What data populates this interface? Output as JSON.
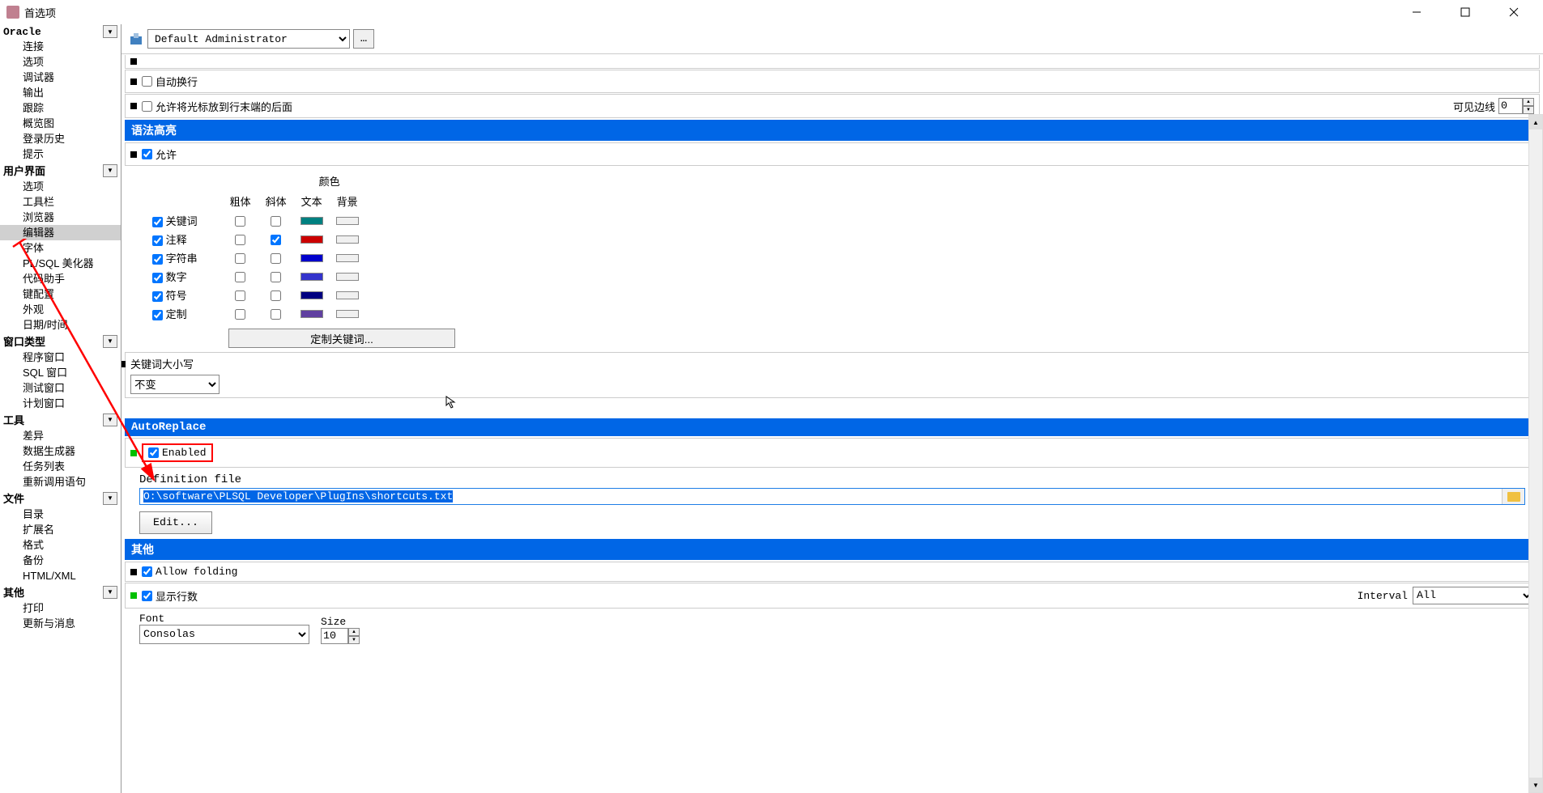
{
  "window": {
    "title": "首选项"
  },
  "sidebar": {
    "categories": [
      {
        "name": "Oracle",
        "items": [
          "连接",
          "选项",
          "调试器",
          "输出",
          "跟踪",
          "概览图",
          "登录历史",
          "提示"
        ]
      },
      {
        "name": "用户界面",
        "items": [
          "选项",
          "工具栏",
          "浏览器",
          "编辑器",
          "字体",
          "PL/SQL 美化器",
          "代码助手",
          "键配置",
          "外观",
          "日期/时间"
        ],
        "selected": "编辑器"
      },
      {
        "name": "窗口类型",
        "items": [
          "程序窗口",
          "SQL 窗口",
          "测试窗口",
          "计划窗口"
        ]
      },
      {
        "name": "工具",
        "items": [
          "差异",
          "数据生成器",
          "任务列表",
          "重新调用语句"
        ]
      },
      {
        "name": "文件",
        "items": [
          "目录",
          "扩展名",
          "格式",
          "备份",
          "HTML/XML"
        ]
      },
      {
        "name": "其他",
        "items": [
          "打印",
          "更新与消息"
        ]
      }
    ]
  },
  "toolbar": {
    "admin_label": "Default Administrator",
    "more": "..."
  },
  "auto_wrap": {
    "label": "自动换行"
  },
  "cursor_allow": {
    "label": "允许将光标放到行末端的后面",
    "visible_border": "可见边线",
    "value": "0"
  },
  "syntax": {
    "header": "语法高亮",
    "allow": "允许",
    "color_title": "颜色",
    "cols": {
      "bold": "粗体",
      "italic": "斜体",
      "text": "文本",
      "bg": "背景"
    },
    "rows": [
      {
        "name": "关键词",
        "checked": true,
        "bold": false,
        "italic": false,
        "text_color": "#008080",
        "bg_color": "#f0f0f0"
      },
      {
        "name": "注释",
        "checked": true,
        "bold": false,
        "italic": true,
        "text_color": "#cc0000",
        "bg_color": "#f0f0f0"
      },
      {
        "name": "字符串",
        "checked": true,
        "bold": false,
        "italic": false,
        "text_color": "#0000cc",
        "bg_color": "#f0f0f0"
      },
      {
        "name": "数字",
        "checked": true,
        "bold": false,
        "italic": false,
        "text_color": "#3333cc",
        "bg_color": "#f0f0f0"
      },
      {
        "name": "符号",
        "checked": true,
        "bold": false,
        "italic": false,
        "text_color": "#000080",
        "bg_color": "#f0f0f0"
      },
      {
        "name": "定制",
        "checked": true,
        "bold": false,
        "italic": false,
        "text_color": "#6040a0",
        "bg_color": "#f0f0f0"
      }
    ],
    "custom_btn": "定制关键词..."
  },
  "keyword_case": {
    "label": "关键词大小写",
    "value": "不变"
  },
  "autoreplace": {
    "header": "AutoReplace",
    "enabled": "Enabled",
    "def_label": "Definition file",
    "path": "O:\\software\\PLSQL Developer\\PlugIns\\shortcuts.txt",
    "edit_btn": "Edit..."
  },
  "other": {
    "header": "其他",
    "allow_folding": "Allow folding",
    "show_lines": "显示行数",
    "interval_label": "Interval",
    "interval_value": "All",
    "font_label": "Font",
    "font_value": "Consolas",
    "size_label": "Size",
    "size_value": "10"
  }
}
